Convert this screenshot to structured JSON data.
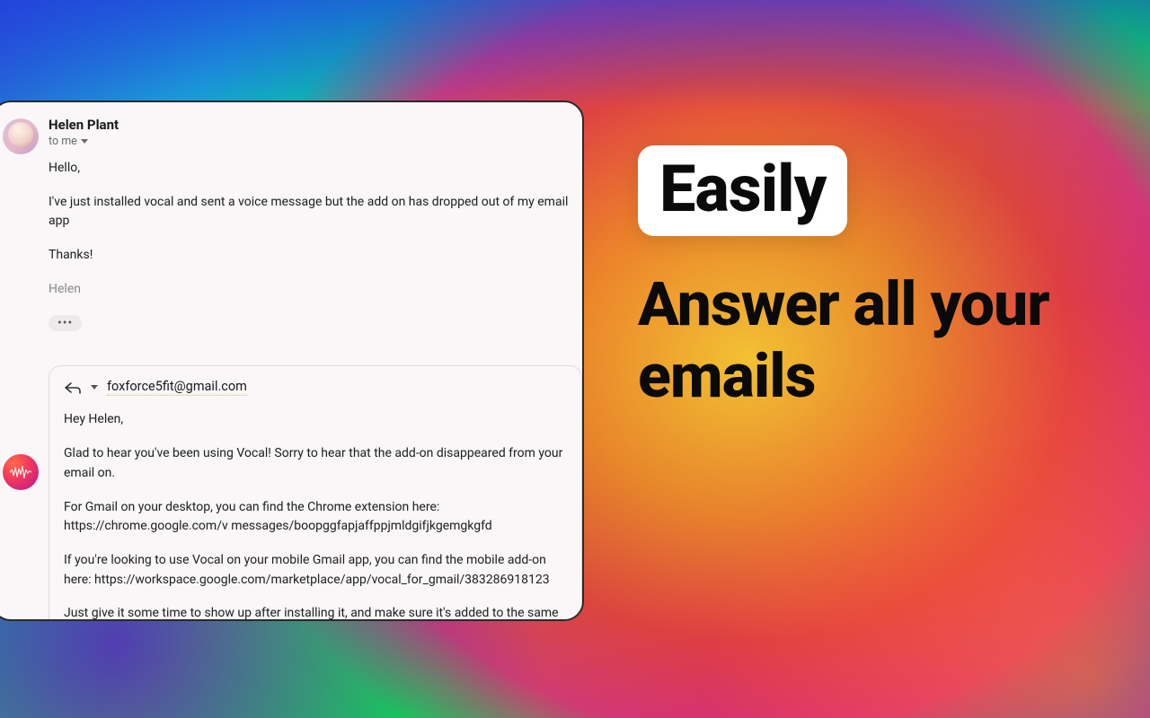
{
  "headline": {
    "badge": "Easily",
    "sub": "Answer all your emails"
  },
  "email": {
    "sender": "Helen Plant",
    "to_line": "to me",
    "paragraphs": {
      "p1": "Hello,",
      "p2": "I've just installed vocal and sent a voice message but the add on has dropped out of my email app",
      "p3": "Thanks!",
      "sig": "Helen"
    },
    "more": "•••"
  },
  "reply": {
    "recipient": "foxforce5fit@gmail.com",
    "paragraphs": {
      "p1": "Hey Helen,",
      "p2": "Glad to hear you've been using Vocal! Sorry to hear that the add-on disappeared from your email on.",
      "p3": "For Gmail on your desktop, you can find the Chrome extension here: https://chrome.google.com/v messages/boopggfapjaffppjmldgifjkgemgkgfd",
      "p4": "If you're looking to use Vocal on your mobile Gmail app, you can find the mobile add-on here: https://workspace.google.com/marketplace/app/vocal_for_gmail/383286918123",
      "p5": "Just give it some time to show up after installing it, and make sure it's added to the same Google"
    }
  }
}
